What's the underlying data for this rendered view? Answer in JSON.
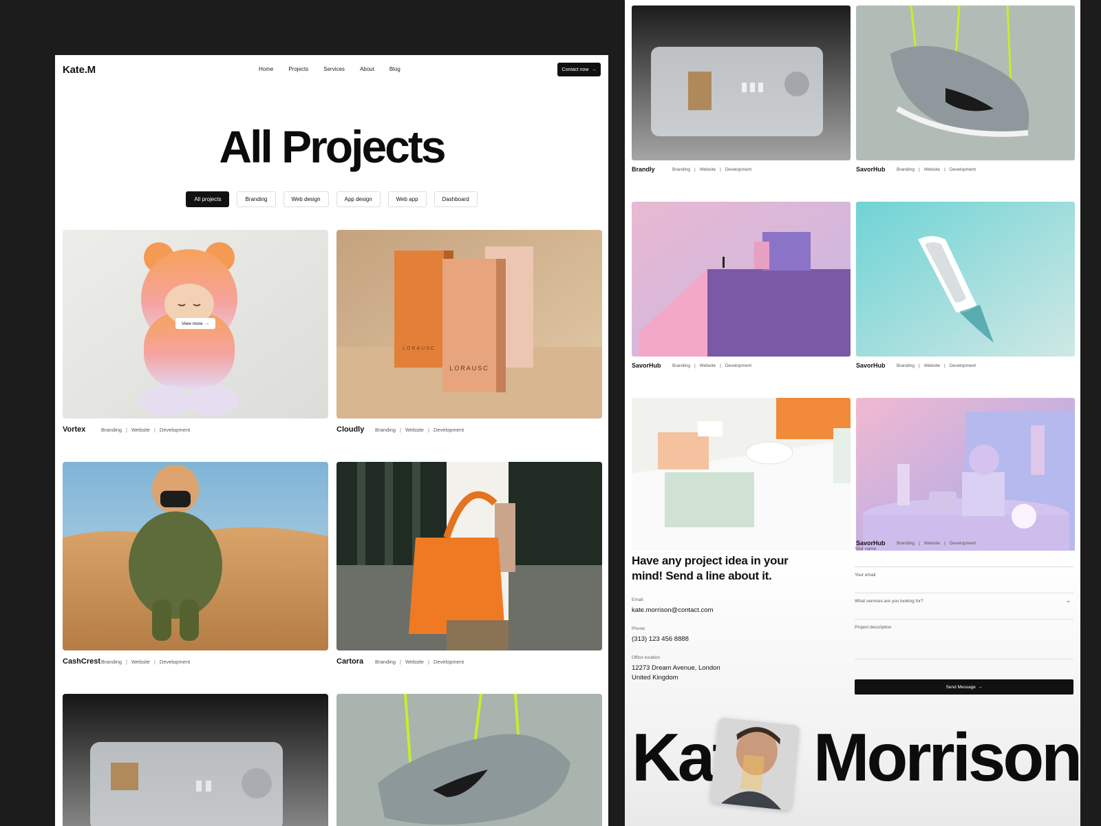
{
  "brand": "Kate.M",
  "nav": [
    "Home",
    "Projects",
    "Services",
    "About",
    "Blog"
  ],
  "contact_button": "Contact now",
  "headline": "All Projects",
  "filters": [
    {
      "label": "All projects",
      "active": true
    },
    {
      "label": "Branding",
      "active": false
    },
    {
      "label": "Web design",
      "active": false
    },
    {
      "label": "App design",
      "active": false
    },
    {
      "label": "Web app",
      "active": false
    },
    {
      "label": "Dashboard",
      "active": false
    }
  ],
  "view_more": "View more",
  "left_projects": [
    {
      "title": "Vortex",
      "tags": [
        "Branding",
        "Website",
        "Development"
      ]
    },
    {
      "title": "Cloudly",
      "tags": [
        "Branding",
        "Website",
        "Development"
      ]
    },
    {
      "title": "CashCrest",
      "tags": [
        "Branding",
        "Website",
        "Development"
      ]
    },
    {
      "title": "Cartora",
      "tags": [
        "Branding",
        "Website",
        "Development"
      ]
    }
  ],
  "box_label": "LORAUSC",
  "right_projects": [
    {
      "title": "Brandly",
      "tags": [
        "Branding",
        "Website",
        "Development"
      ]
    },
    {
      "title": "SavorHub",
      "tags": [
        "Branding",
        "Website",
        "Development"
      ]
    },
    {
      "title": "SavorHub",
      "tags": [
        "Branding",
        "Website",
        "Development"
      ]
    },
    {
      "title": "SavorHub",
      "tags": [
        "Branding",
        "Website",
        "Development"
      ]
    },
    {
      "title": "SavorHub",
      "tags": [
        "Branding",
        "Website",
        "Development"
      ]
    }
  ],
  "contact": {
    "heading": "Have any project idea in your mind! Send a line about it.",
    "email_label": "Email:",
    "email": "kate.morrison@contact.com",
    "phone_label": "Phone:",
    "phone": "(313) 123 456 8888",
    "office_label": "Office location",
    "office_line1": "12273 Dream Avenue, London",
    "office_line2": "United Kingdom",
    "fields": {
      "name": "Your name",
      "email": "Your email",
      "services": "What services are you looking for?",
      "description": "Project description"
    },
    "send": "Send Message"
  },
  "big_name_left": "Kat",
  "big_name_right": "Morrison"
}
